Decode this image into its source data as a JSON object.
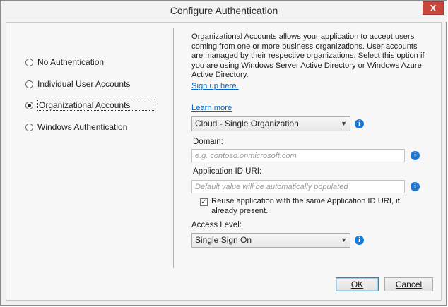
{
  "window": {
    "title": "Configure Authentication",
    "close_glyph": "X"
  },
  "auth_options": [
    {
      "label": "No Authentication",
      "checked": false
    },
    {
      "label": "Individual User Accounts",
      "checked": false
    },
    {
      "label": "Organizational Accounts",
      "checked": true
    },
    {
      "label": "Windows Authentication",
      "checked": false
    }
  ],
  "details": {
    "description": "Organizational Accounts allows your application to accept users coming from one or more business organizations. User accounts are managed by their respective organizations. Select this option if you are using Windows Server Active Directory or Windows Azure Active Directory.",
    "signup_link": "Sign up here.",
    "learn_more_link": "Learn more",
    "org_type_selected": "Cloud - Single Organization",
    "domain_label": "Domain:",
    "domain_placeholder": "e.g. contoso.onmicrosoft.com",
    "app_id_label": "Application ID URI:",
    "app_id_placeholder": "Default value will be automatically populated",
    "reuse_checked": true,
    "reuse_label": "Reuse application with the same Application ID URI, if already present.",
    "access_level_label": "Access Level:",
    "access_level_selected": "Single Sign On"
  },
  "buttons": {
    "ok": "OK",
    "cancel": "Cancel"
  },
  "icons": {
    "info": "info-icon",
    "dropdown": "chevron-down-icon",
    "check": "checkmark-icon"
  },
  "colors": {
    "link": "#0066cc",
    "info": "#1a79d6",
    "close": "#c7473d"
  }
}
